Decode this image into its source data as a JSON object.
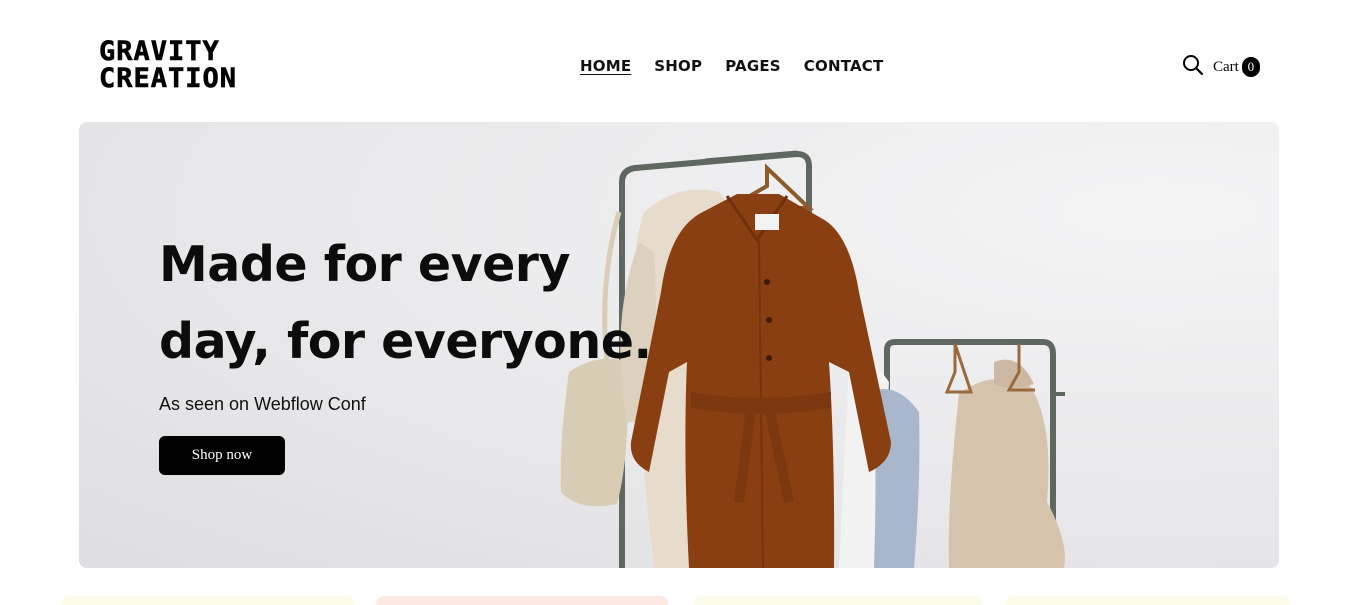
{
  "header": {
    "logo_line1": "GRAVITY",
    "logo_line2": "CREATION",
    "nav": [
      {
        "label": "HOME",
        "active": true
      },
      {
        "label": "SHOP"
      },
      {
        "label": "PAGES"
      },
      {
        "label": "CONTACT"
      }
    ],
    "search_icon": "search-icon",
    "cart_label": "Cart",
    "cart_count": "0"
  },
  "hero": {
    "title": "Made for every day, for everyone.",
    "subtitle": "As seen on Webflow Conf",
    "cta_label": "Shop now"
  },
  "colors": {
    "accent": "#000000",
    "hero_bg": "#e9e9eb",
    "coat": "#8a3f12",
    "rack": "#5f6860"
  }
}
